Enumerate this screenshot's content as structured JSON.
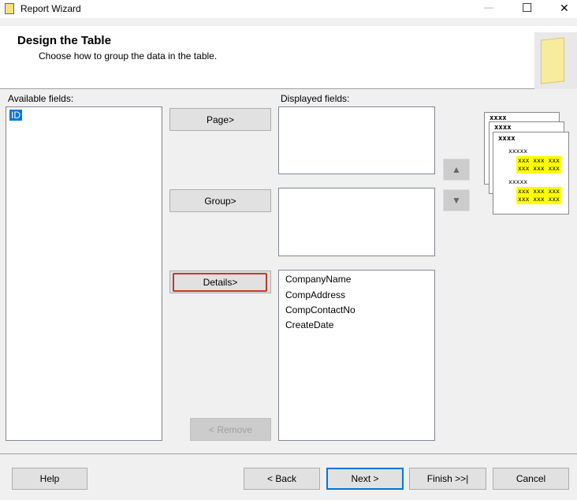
{
  "window": {
    "title": "Report Wizard",
    "minimize": "—",
    "maximize": "☐",
    "close": "✕"
  },
  "header": {
    "title": "Design the Table",
    "subtitle": "Choose how to group the data in the table."
  },
  "available": {
    "label": "Available fields:",
    "items": [
      "ID"
    ]
  },
  "displayed": {
    "label": "Displayed fields:",
    "details_items": [
      "CompanyName",
      "CompAddress",
      "CompContactNo",
      "CreateDate"
    ]
  },
  "buttons": {
    "page": "Page>",
    "group": "Group>",
    "details": "Details>",
    "remove": "< Remove",
    "help": "Help",
    "back": "< Back",
    "next": "Next >",
    "finish": "Finish >>|",
    "cancel": "Cancel"
  },
  "preview": {
    "h": "xxxx",
    "sub": "xxxxx",
    "cells": "xxx xxx xxx\nxxx xxx xxx"
  }
}
